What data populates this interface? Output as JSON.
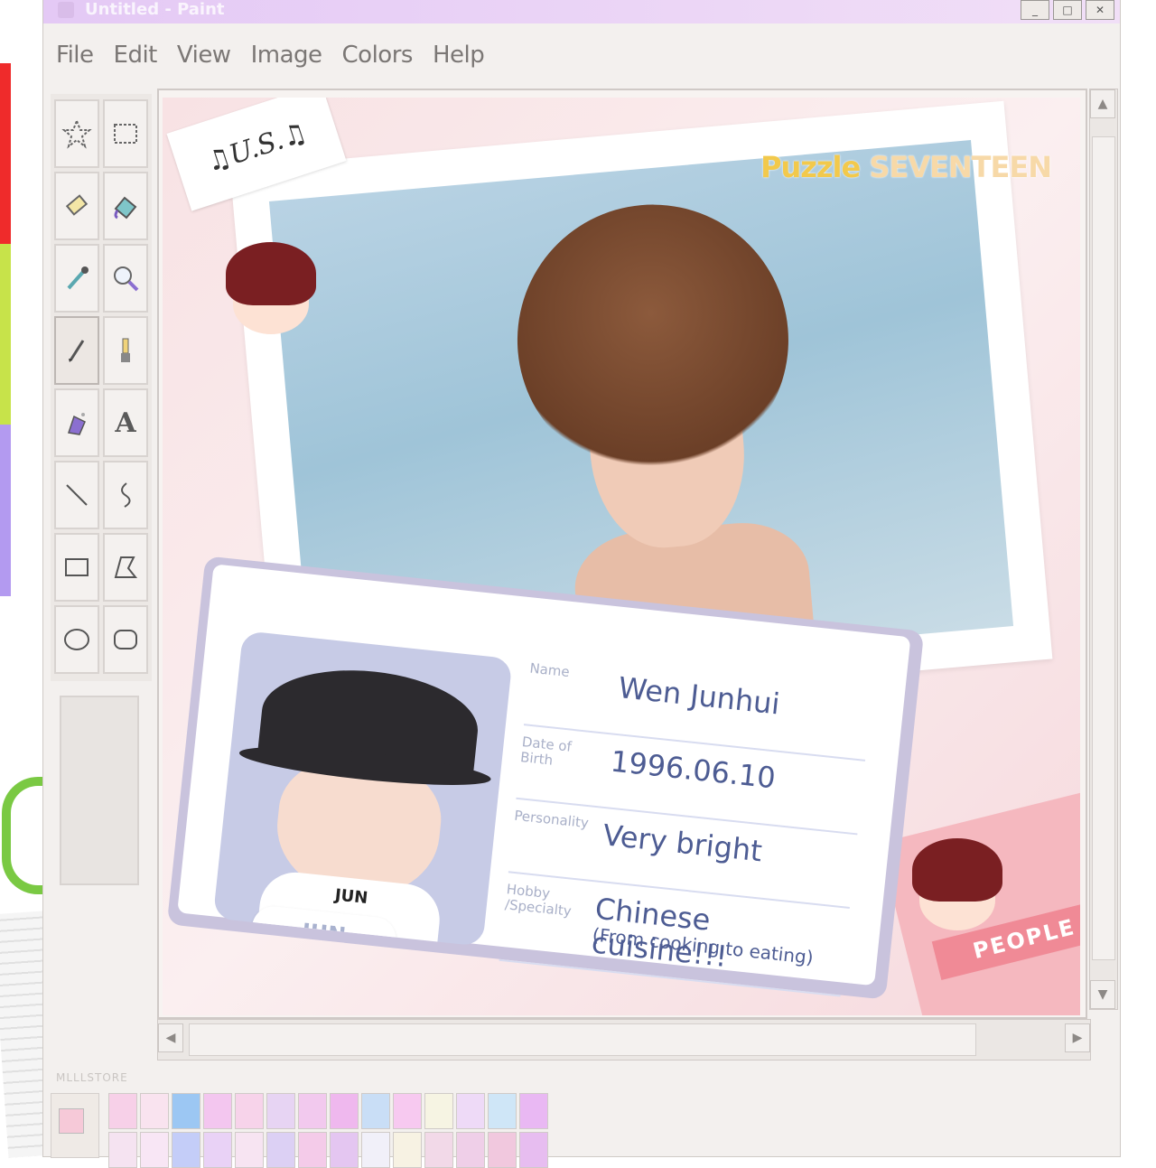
{
  "window": {
    "title": "Untitled - Paint",
    "controls": [
      "_",
      "□",
      "✕"
    ]
  },
  "menu": [
    "File",
    "Edit",
    "View",
    "Image",
    "Colors",
    "Help"
  ],
  "tools": [
    {
      "name": "free-form-select",
      "icon": "star-select-icon"
    },
    {
      "name": "rect-select",
      "icon": "rect-select-icon"
    },
    {
      "name": "eraser",
      "icon": "eraser-icon"
    },
    {
      "name": "fill",
      "icon": "fill-bucket-icon"
    },
    {
      "name": "pick-color",
      "icon": "eyedropper-icon"
    },
    {
      "name": "magnifier",
      "icon": "magnifier-icon"
    },
    {
      "name": "pencil",
      "icon": "pencil-icon"
    },
    {
      "name": "brush",
      "icon": "brush-icon"
    },
    {
      "name": "airbrush",
      "icon": "airbrush-icon"
    },
    {
      "name": "text",
      "icon": "text-icon",
      "glyph": "A"
    },
    {
      "name": "line",
      "icon": "line-icon"
    },
    {
      "name": "curve",
      "icon": "curve-icon"
    },
    {
      "name": "rectangle",
      "icon": "rectangle-icon"
    },
    {
      "name": "polygon",
      "icon": "polygon-icon"
    },
    {
      "name": "ellipse",
      "icon": "ellipse-icon"
    },
    {
      "name": "rounded-rectangle",
      "icon": "rounded-rect-icon"
    }
  ],
  "canvas": {
    "watermark_a": "Puzzle",
    "watermark_b": "SEVENTEEN",
    "sticker_text": "♫U.S.♫",
    "pink_label": "PEOPLE",
    "id_card": {
      "avatar_shirt": "JUN",
      "avatar_tag": "JUN",
      "fields": [
        {
          "label": "Name",
          "value": "Wen Junhui",
          "sub": ""
        },
        {
          "label": "Date of Birth",
          "value": "1996.06.10",
          "sub": ""
        },
        {
          "label": "Personality",
          "value": "Very bright",
          "sub": ""
        },
        {
          "label": "Hobby /Specialty",
          "value": "Chinese cuisine!!!",
          "sub": "(From cooking to eating)"
        }
      ]
    }
  },
  "status_tag": "MLLLSTORE",
  "palette": {
    "current_fg": "#f6c9d8",
    "colors": [
      "#f7d0e8",
      "#f9e3ef",
      "#9cc7f3",
      "#f3c6ef",
      "#f7d3ea",
      "#e7d4f3",
      "#f2c9ee",
      "#efb8ee",
      "#c9def6",
      "#f7c9f0",
      "#f6f4e3",
      "#eedaf7",
      "#cfe6f7",
      "#e9b8f3",
      "#f5e3f1",
      "#f8e6f5",
      "#c4cdf8",
      "#e9d2f6",
      "#f7e4f2",
      "#dcd0f4",
      "#f4cbe9",
      "#e4c6f1",
      "#f1f0f9",
      "#f7f2e3",
      "#f2d9e8",
      "#efcfe8",
      "#f1c8de",
      "#e7bdf0"
    ]
  }
}
